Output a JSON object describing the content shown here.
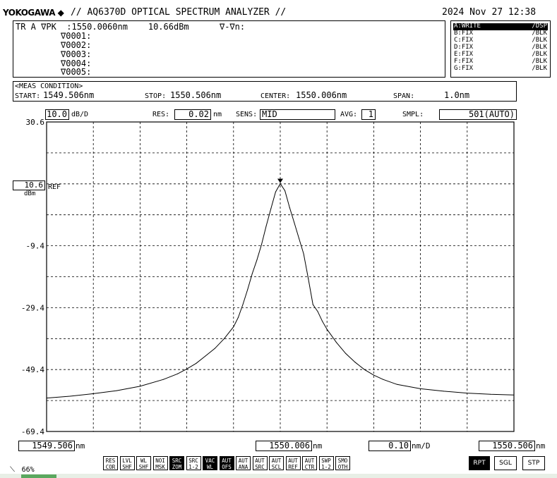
{
  "header": {
    "brand": "YOKOGAWA ◆",
    "title": "// AQ6370D OPTICAL SPECTRUM ANALYZER //",
    "datetime": "2024 Nov 27 12:38"
  },
  "marker_panel": {
    "line1": "TR A ∇PK  :1550.0060nm    10.66dBm      ∇-∇n:",
    "markers": [
      "∇0001:",
      "∇0002:",
      "∇0003:",
      "∇0004:",
      "∇0005:"
    ]
  },
  "trace_list": [
    {
      "label": "A:WRITE",
      "mode": "/DSP",
      "active": true
    },
    {
      "label": "B:FIX",
      "mode": "/BLK",
      "active": false
    },
    {
      "label": "C:FIX",
      "mode": "/BLK",
      "active": false
    },
    {
      "label": "D:FIX",
      "mode": "/BLK",
      "active": false
    },
    {
      "label": "E:FIX",
      "mode": "/BLK",
      "active": false
    },
    {
      "label": "F:FIX",
      "mode": "/BLK",
      "active": false
    },
    {
      "label": "G:FIX",
      "mode": "/BLK",
      "active": false
    }
  ],
  "meas_condition": {
    "title": "<MEAS CONDITION>",
    "start_label": "START:",
    "start_value": "1549.506nm",
    "stop_label": "STOP:",
    "stop_value": "1550.506nm",
    "center_label": "CENTER:",
    "center_value": "1550.006nm",
    "span_label": "SPAN:",
    "span_value": "1.0nm"
  },
  "settings": {
    "scale_value": "10.0",
    "scale_unit": "dB/D",
    "res_label": "RES:",
    "res_value": "0.02",
    "res_unit": "nm",
    "sens_label": "SENS:",
    "sens_value": "MID",
    "avg_label": "AVG:",
    "avg_value": "1",
    "smpl_label": "SMPL:",
    "smpl_value": "501(AUTO)"
  },
  "ref": {
    "value": "10.6",
    "unit": "dBm",
    "label": "REF"
  },
  "bottom_axis": {
    "start": "1549.506",
    "start_unit": "nm",
    "center": "1550.006",
    "center_unit": "nm",
    "div": "0.10",
    "div_unit": "nm/D",
    "stop": "1550.506",
    "stop_unit": "nm"
  },
  "status": {
    "progress_text": "66%"
  },
  "softkeys": [
    {
      "label": "RES\nCOR",
      "inverted": false
    },
    {
      "label": "LVL\nSHF",
      "inverted": false
    },
    {
      "label": "WL\nSHF",
      "inverted": false
    },
    {
      "label": "NOI\nMSK",
      "inverted": false
    },
    {
      "label": "SRC\nZOM",
      "inverted": true
    },
    {
      "label": "SRC\n1-2",
      "inverted": false
    },
    {
      "label": "VAC\nWL",
      "inverted": true
    },
    {
      "label": "AUT\nOFS",
      "inverted": true
    },
    {
      "label": "AUT\nANA",
      "inverted": false
    },
    {
      "label": "AUT\nSRC",
      "inverted": false
    },
    {
      "label": "AUT\nSCL",
      "inverted": false
    },
    {
      "label": "AUT\nREF",
      "inverted": false
    },
    {
      "label": "AUT\nCTR",
      "inverted": false
    },
    {
      "label": "SWP\n1-2",
      "inverted": false
    },
    {
      "label": "SMO\nOTH",
      "inverted": false
    }
  ],
  "sweep_buttons": [
    {
      "label": "RPT",
      "inverted": true
    },
    {
      "label": "SGL",
      "inverted": false
    },
    {
      "label": "STP",
      "inverted": false
    }
  ],
  "chart_data": {
    "type": "line",
    "title": "",
    "xlabel": "",
    "ylabel": "",
    "x_unit": "nm",
    "y_unit": "dBm",
    "xlim": [
      1549.506,
      1550.506
    ],
    "ylim": [
      -69.4,
      30.6
    ],
    "y_ticks": [
      "30.6",
      "10.6",
      "-9.4",
      "-29.4",
      "-49.4",
      "-69.4"
    ],
    "y_tick_values": [
      30.6,
      10.6,
      -9.4,
      -29.4,
      -49.4,
      -69.4
    ],
    "grid": true,
    "peak_marker": {
      "x": 1550.006,
      "y": 10.66
    },
    "series": [
      {
        "color": "#000000",
        "x": [
          1549.506,
          1549.556,
          1549.606,
          1549.656,
          1549.706,
          1549.756,
          1549.786,
          1549.806,
          1549.826,
          1549.846,
          1549.866,
          1549.886,
          1549.906,
          1549.916,
          1549.926,
          1549.936,
          1549.946,
          1549.956,
          1549.966,
          1549.976,
          1549.986,
          1549.996,
          1550.006,
          1550.016,
          1550.026,
          1550.036,
          1550.046,
          1550.056,
          1550.066,
          1550.076,
          1550.086,
          1550.096,
          1550.106,
          1550.126,
          1550.146,
          1550.166,
          1550.186,
          1550.206,
          1550.226,
          1550.256,
          1550.306,
          1550.356,
          1550.406,
          1550.456,
          1550.506
        ],
        "y": [
          -58.6,
          -58.0,
          -57.2,
          -56.2,
          -54.8,
          -52.6,
          -50.8,
          -49.2,
          -47.4,
          -45.0,
          -42.6,
          -39.4,
          -35.6,
          -32.6,
          -28.4,
          -23.6,
          -18.4,
          -14.0,
          -9.0,
          -3.0,
          2.6,
          8.0,
          10.66,
          8.4,
          3.0,
          -2.0,
          -7.0,
          -12.0,
          -20.0,
          -28.4,
          -30.6,
          -33.8,
          -36.4,
          -40.6,
          -44.2,
          -47.0,
          -49.4,
          -51.2,
          -52.6,
          -54.2,
          -55.6,
          -56.4,
          -57.0,
          -57.4,
          -57.6
        ]
      }
    ]
  }
}
